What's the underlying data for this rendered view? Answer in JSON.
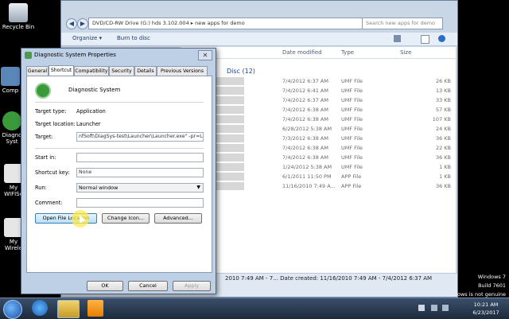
{
  "desktop": {
    "icons": [
      {
        "label": "Recycle Bin"
      },
      {
        "label": "Comp"
      },
      {
        "label": "Diagno"
      },
      {
        "label": "Syst"
      },
      {
        "label": "My"
      },
      {
        "label": "WIFISe"
      },
      {
        "label": "My"
      },
      {
        "label": "Wirele"
      }
    ],
    "watermark": {
      "line1": "Windows 7",
      "line2": "Build 7601",
      "line3": "ows is not genuine"
    }
  },
  "explorer": {
    "address": "DVD/CD-RW Drive (G:) hds 3.102.004  ▸  new apps for demo",
    "search_placeholder": "Search new apps for demo",
    "toolbar": {
      "organize": "Organize ▾",
      "burn": "Burn to disc"
    },
    "columns": {
      "date": "Date modified",
      "type": "Type",
      "size": "Size"
    },
    "group_header": "Disc (12)",
    "rows": [
      {
        "date": "7/4/2012 6:37 AM",
        "type": "UMF File",
        "size": "26 KB"
      },
      {
        "date": "7/4/2012 6:41 AM",
        "type": "UMF File",
        "size": "13 KB"
      },
      {
        "date": "7/4/2012 6:37 AM",
        "type": "UMF File",
        "size": "33 KB"
      },
      {
        "date": "7/4/2012 6:38 AM",
        "type": "UMF File",
        "size": "57 KB"
      },
      {
        "date": "7/4/2012 6:38 AM",
        "type": "UMF File",
        "size": "107 KB"
      },
      {
        "date": "6/28/2012 5:38 AM",
        "type": "UMF File",
        "size": "24 KB"
      },
      {
        "date": "7/3/2012 6:38 AM",
        "type": "UMF File",
        "size": "36 KB"
      },
      {
        "date": "7/4/2012 6:38 AM",
        "type": "UMF File",
        "size": "22 KB"
      },
      {
        "date": "7/4/2012 6:38 AM",
        "type": "UMF File",
        "size": "36 KB"
      },
      {
        "date": "1/24/2012 5:38 AM",
        "type": "UMF File",
        "size": "1 KB"
      },
      {
        "date": "6/1/2011 11:50 PM",
        "type": "APP File",
        "size": "1 KB"
      },
      {
        "date": "11/16/2010 7:49 A...",
        "type": "APP File",
        "size": "36 KB"
      }
    ],
    "details": "2010 7:49 AM - 7...  Date created: 11/16/2010 7:49 AM - 7/4/2012 6:37 AM"
  },
  "dialog": {
    "title": "Diagnostic System Properties",
    "close": "✕",
    "tabs": [
      "General",
      "Shortcut",
      "Compatibility",
      "Security",
      "Details",
      "Previous Versions"
    ],
    "app_name": "Diagnostic System",
    "fields": {
      "target_type_label": "Target type:",
      "target_type_value": "Application",
      "target_location_label": "Target location:",
      "target_location_value": "Launcher",
      "target_label": "Target:",
      "target_value": "nfSoft\\DiagSys-test\\Launcher\\Launcher.exe\" -pr=Launch",
      "start_in_label": "Start in:",
      "start_in_value": "",
      "shortcut_key_label": "Shortcut key:",
      "shortcut_key_value": "None",
      "run_label": "Run:",
      "run_value": "Normal window",
      "comment_label": "Comment:",
      "comment_value": ""
    },
    "buttons": {
      "open_file_location": "Open File Location",
      "change_icon": "Change Icon...",
      "advanced": "Advanced...",
      "ok": "OK",
      "cancel": "Cancel",
      "apply": "Apply"
    }
  },
  "taskbar": {
    "time": "10:21 AM",
    "date": "6/23/2017"
  }
}
